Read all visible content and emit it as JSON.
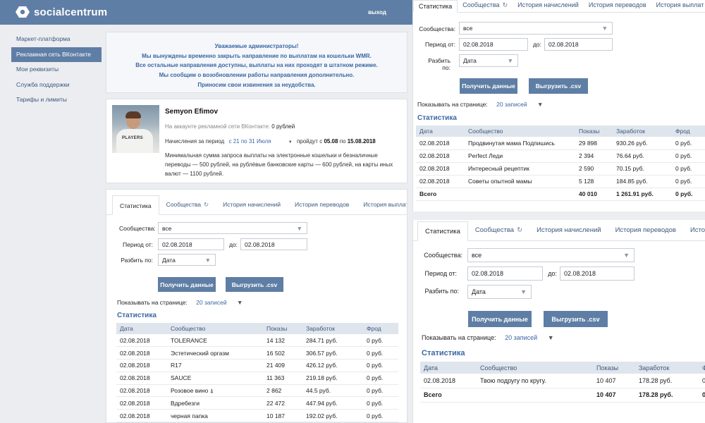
{
  "app": {
    "logo_text": "socialcentrum",
    "exit_label": "выход"
  },
  "sidebar": {
    "items": [
      {
        "label": "Маркет-платформа"
      },
      {
        "label": "Рекламная сеть ВКонтакте"
      },
      {
        "label": "Мои реквизиты"
      },
      {
        "label": "Служба поддержки"
      },
      {
        "label": "Тарифы и лимиты"
      }
    ]
  },
  "notice": {
    "lines": [
      "Уважаемые администраторы!",
      "Мы вынуждены временно закрыть направление по выплатам на кошельки WMR.",
      "Все остальные направления доступны, выплаты на них проходят в штатном режиме.",
      "Мы сообщим о возобновлении работы направления дополнительно.",
      "Приносим свои извинения за неудобства."
    ]
  },
  "profile": {
    "name": "Semyon Efimov",
    "shirt_text": "PLAYERS",
    "balance_label": "На аккаунте рекламной сети ВКонтакте:",
    "balance_value": "0 рублей",
    "accrual_label": "Начисления за период",
    "accrual_period": "с 21 по 31 Июля",
    "accrual_pass": "пройдут с",
    "accrual_from": "05.08",
    "accrual_to_word": "по",
    "accrual_to": "15.08.2018",
    "description": "Минимальная сумма запроса выплаты на электронные кошельки и безналичные переводы — 500 рублей, на рублёвые банковские карты — 600 рублей, на карты иных валют — 1100 рублей."
  },
  "widget_common": {
    "tabs": [
      "Статистика",
      "Сообщества",
      "История начислений",
      "История переводов",
      "История выплат"
    ],
    "communities_label": "Сообщества:",
    "communities_value": "все",
    "period_label": "Период от:",
    "period_from": "02.08.2018",
    "period_to_label": "до:",
    "period_to": "02.08.2018",
    "split_label": "Разбить по:",
    "split_value": "Дата",
    "get_data_button": "Получить данные",
    "export_button": "Выгрузить .csv",
    "per_page_label": "Показывать на странице:",
    "per_page_value": "20 записей",
    "stats_heading": "Статистика",
    "columns": [
      "Дата",
      "Сообщество",
      "Показы",
      "Заработок",
      "Фрод"
    ]
  },
  "left_table": {
    "rows": [
      [
        "02.08.2018",
        "TOLERANCE",
        "14 132",
        "284.71 руб.",
        "0 руб."
      ],
      [
        "02.08.2018",
        "Эстетический оргазм",
        "16 502",
        "306.57 руб.",
        "0 руб."
      ],
      [
        "02.08.2018",
        "R17",
        "21 409",
        "426.12 руб.",
        "0 руб."
      ],
      [
        "02.08.2018",
        "SAUCE",
        "11 363",
        "219.18 руб.",
        "0 руб."
      ],
      [
        "02.08.2018",
        "Розовое вино ⍋",
        "2 862",
        "44.5 руб.",
        "0 руб."
      ],
      [
        "02.08.2018",
        "Вдребезги",
        "22 472",
        "447.94 руб.",
        "0 руб."
      ],
      [
        "02.08.2018",
        "черная папка",
        "10 187",
        "192.02 руб.",
        "0 руб."
      ]
    ]
  },
  "right_top_table": {
    "rows": [
      [
        "02.08.2018",
        "Продвинутая мама Подпишись",
        "29 898",
        "930.26 руб.",
        "0 руб."
      ],
      [
        "02.08.2018",
        "Perfect Леди",
        "2 394",
        "76.64 руб.",
        "0 руб."
      ],
      [
        "02.08.2018",
        "Интересный рецептик",
        "2 590",
        "70.15 руб.",
        "0 руб."
      ],
      [
        "02.08.2018",
        "Советы опытной мамы",
        "5 128",
        "184.85 руб.",
        "0 руб."
      ]
    ],
    "total": [
      "Всего",
      "",
      "40 010",
      "1 261.91 руб.",
      "0 руб."
    ]
  },
  "right_bottom_table": {
    "rows": [
      [
        "02.08.2018",
        "Твою подругу по кругу.",
        "10 407",
        "178.28 руб.",
        "0 руб."
      ]
    ],
    "total": [
      "Всего",
      "",
      "10 407",
      "178.28 руб.",
      "0 руб."
    ]
  },
  "colors": {
    "brand": "#5f7ea5",
    "link": "#3a67a3",
    "page_bg": "#ebedf0"
  }
}
